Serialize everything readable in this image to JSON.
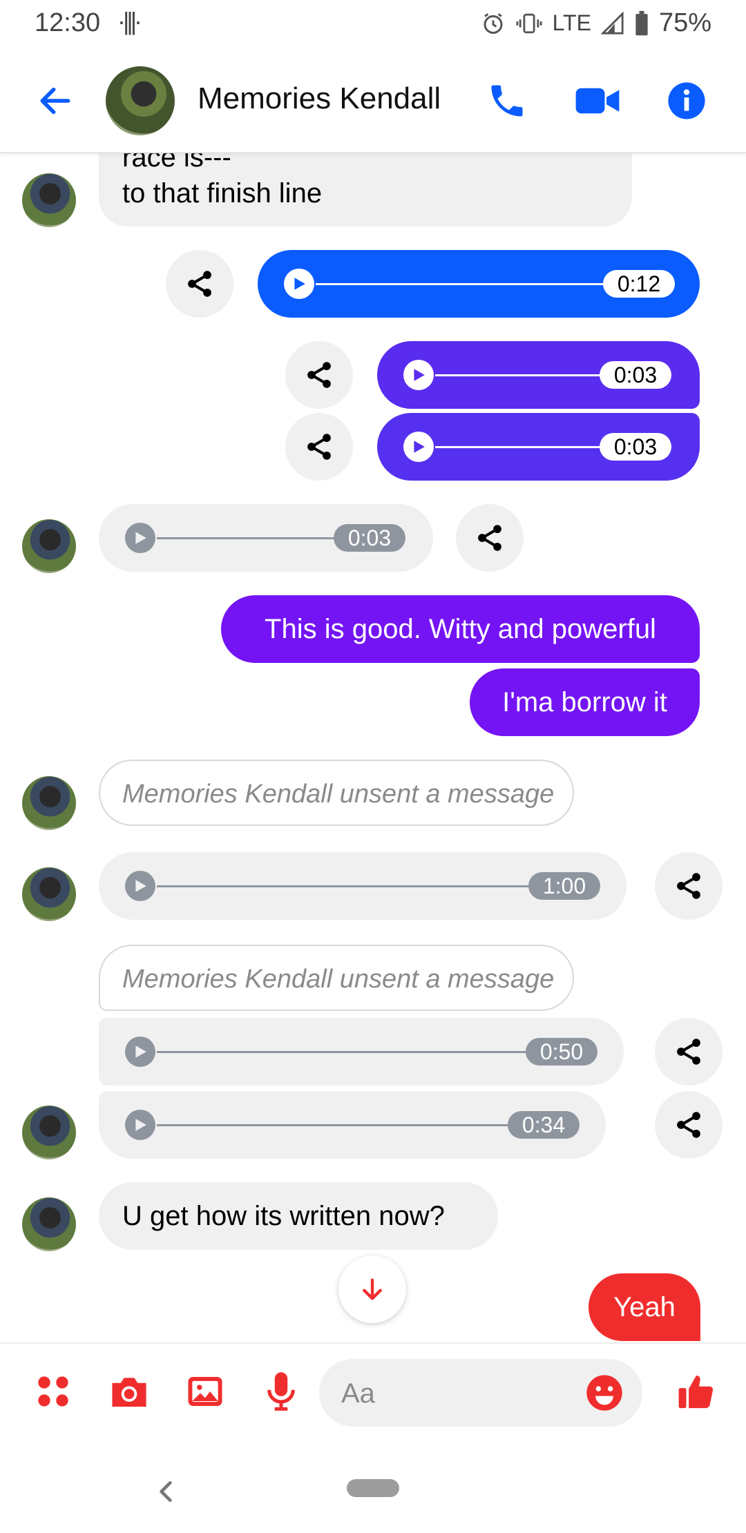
{
  "status_bar": {
    "time": "12:30",
    "lte": "LTE",
    "battery": "75%"
  },
  "header": {
    "contact_name": "Memories Kendall"
  },
  "messages": {
    "text_top_line1": "race is---",
    "text_top_line2": "to that finish line",
    "audio_out_1": "0:12",
    "audio_out_2": "0:03",
    "audio_out_3": "0:03",
    "audio_in_1": "0:03",
    "out_text_1": "This is good. Witty and powerful",
    "out_text_2": "I'ma borrow it",
    "unsent_1": "Memories Kendall unsent a message",
    "audio_in_2": "1:00",
    "unsent_2": "Memories Kendall unsent a message",
    "audio_in_3": "0:50",
    "audio_in_4": "0:34",
    "in_text_last": "U get how its written now?",
    "quick_reply": "Yeah"
  },
  "composer": {
    "placeholder": "Aa"
  },
  "colors": {
    "accent_blue": "#0a5cff",
    "accent_red": "#f02d2d",
    "purple": "#7414f5"
  }
}
